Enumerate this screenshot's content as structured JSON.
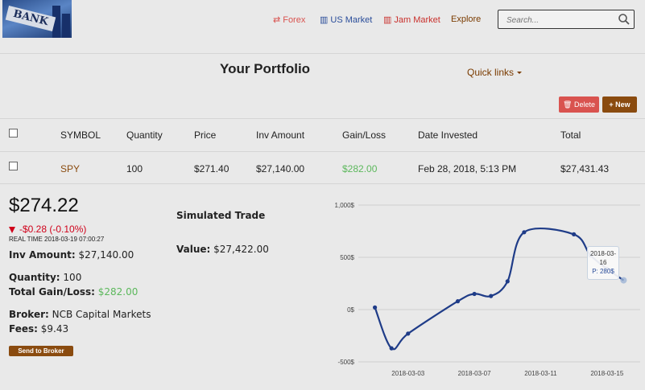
{
  "header": {
    "logo_text": "BANK",
    "nav": [
      {
        "label": "Forex",
        "icon": "exchange-icon",
        "color": "#d9534f"
      },
      {
        "label": "US Market",
        "icon": "bar-chart-icon",
        "color": "#2a4d9a"
      },
      {
        "label": "Jam Market",
        "icon": "bar-chart-icon",
        "color": "#c9302c"
      },
      {
        "label": "Explore",
        "color": "#7a3b00"
      }
    ],
    "search_placeholder": "Search..."
  },
  "page": {
    "title": "Your Portfolio",
    "quick_links": "Quick links",
    "delete_label": "Delete",
    "new_label": "New"
  },
  "table": {
    "columns": [
      "SYMBOL",
      "Quantity",
      "Price",
      "Inv Amount",
      "Gain/Loss",
      "Date Invested",
      "Total"
    ],
    "rows": [
      {
        "symbol": "SPY",
        "quantity": "100",
        "price": "$271.40",
        "inv_amount": "$27,140.00",
        "gain_loss": "$282.00",
        "date": "Feb 28, 2018, 5:13 PM",
        "total": "$27,431.43"
      }
    ]
  },
  "detail": {
    "price": "$274.22",
    "change": "-$0.28 (-0.10%)",
    "real_time": "REAL TIME 2018-03-19 07:00:27",
    "inv_amount_label": "Inv Amount:",
    "inv_amount": "$27,140.00",
    "quantity_label": "Quantity:",
    "quantity": "100",
    "gain_label": "Total Gain/Loss:",
    "gain": "$282.00",
    "broker_label": "Broker:",
    "broker": "NCB Capital Markets",
    "fees_label": "Fees:",
    "fees": "$9.43",
    "send_label": "Send to Broker"
  },
  "simulated": {
    "title": "Simulated Trade",
    "value_label": "Value:",
    "value": "$27,422.00"
  },
  "chart_data": {
    "type": "line",
    "x": [
      "2018-03-01",
      "2018-03-02",
      "2018-03-03",
      "2018-03-06",
      "2018-03-07",
      "2018-03-08",
      "2018-03-09",
      "2018-03-10",
      "2018-03-13",
      "2018-03-14",
      "2018-03-15",
      "2018-03-16"
    ],
    "values": [
      20,
      -370,
      -230,
      80,
      150,
      130,
      270,
      740,
      720,
      520,
      390,
      280
    ],
    "y_ticks": [
      "1,000$",
      "500$",
      "0$",
      "-500$"
    ],
    "x_ticks": [
      "2018-03-03",
      "2018-03-07",
      "2018-03-11",
      "2018-03-15"
    ],
    "ylim": [
      -500,
      1000
    ],
    "grid": true,
    "line_color": "#1f3c88",
    "tooltip": {
      "date_line1": "2018-03-",
      "date_line2": "16",
      "value": "P: 280$"
    }
  }
}
